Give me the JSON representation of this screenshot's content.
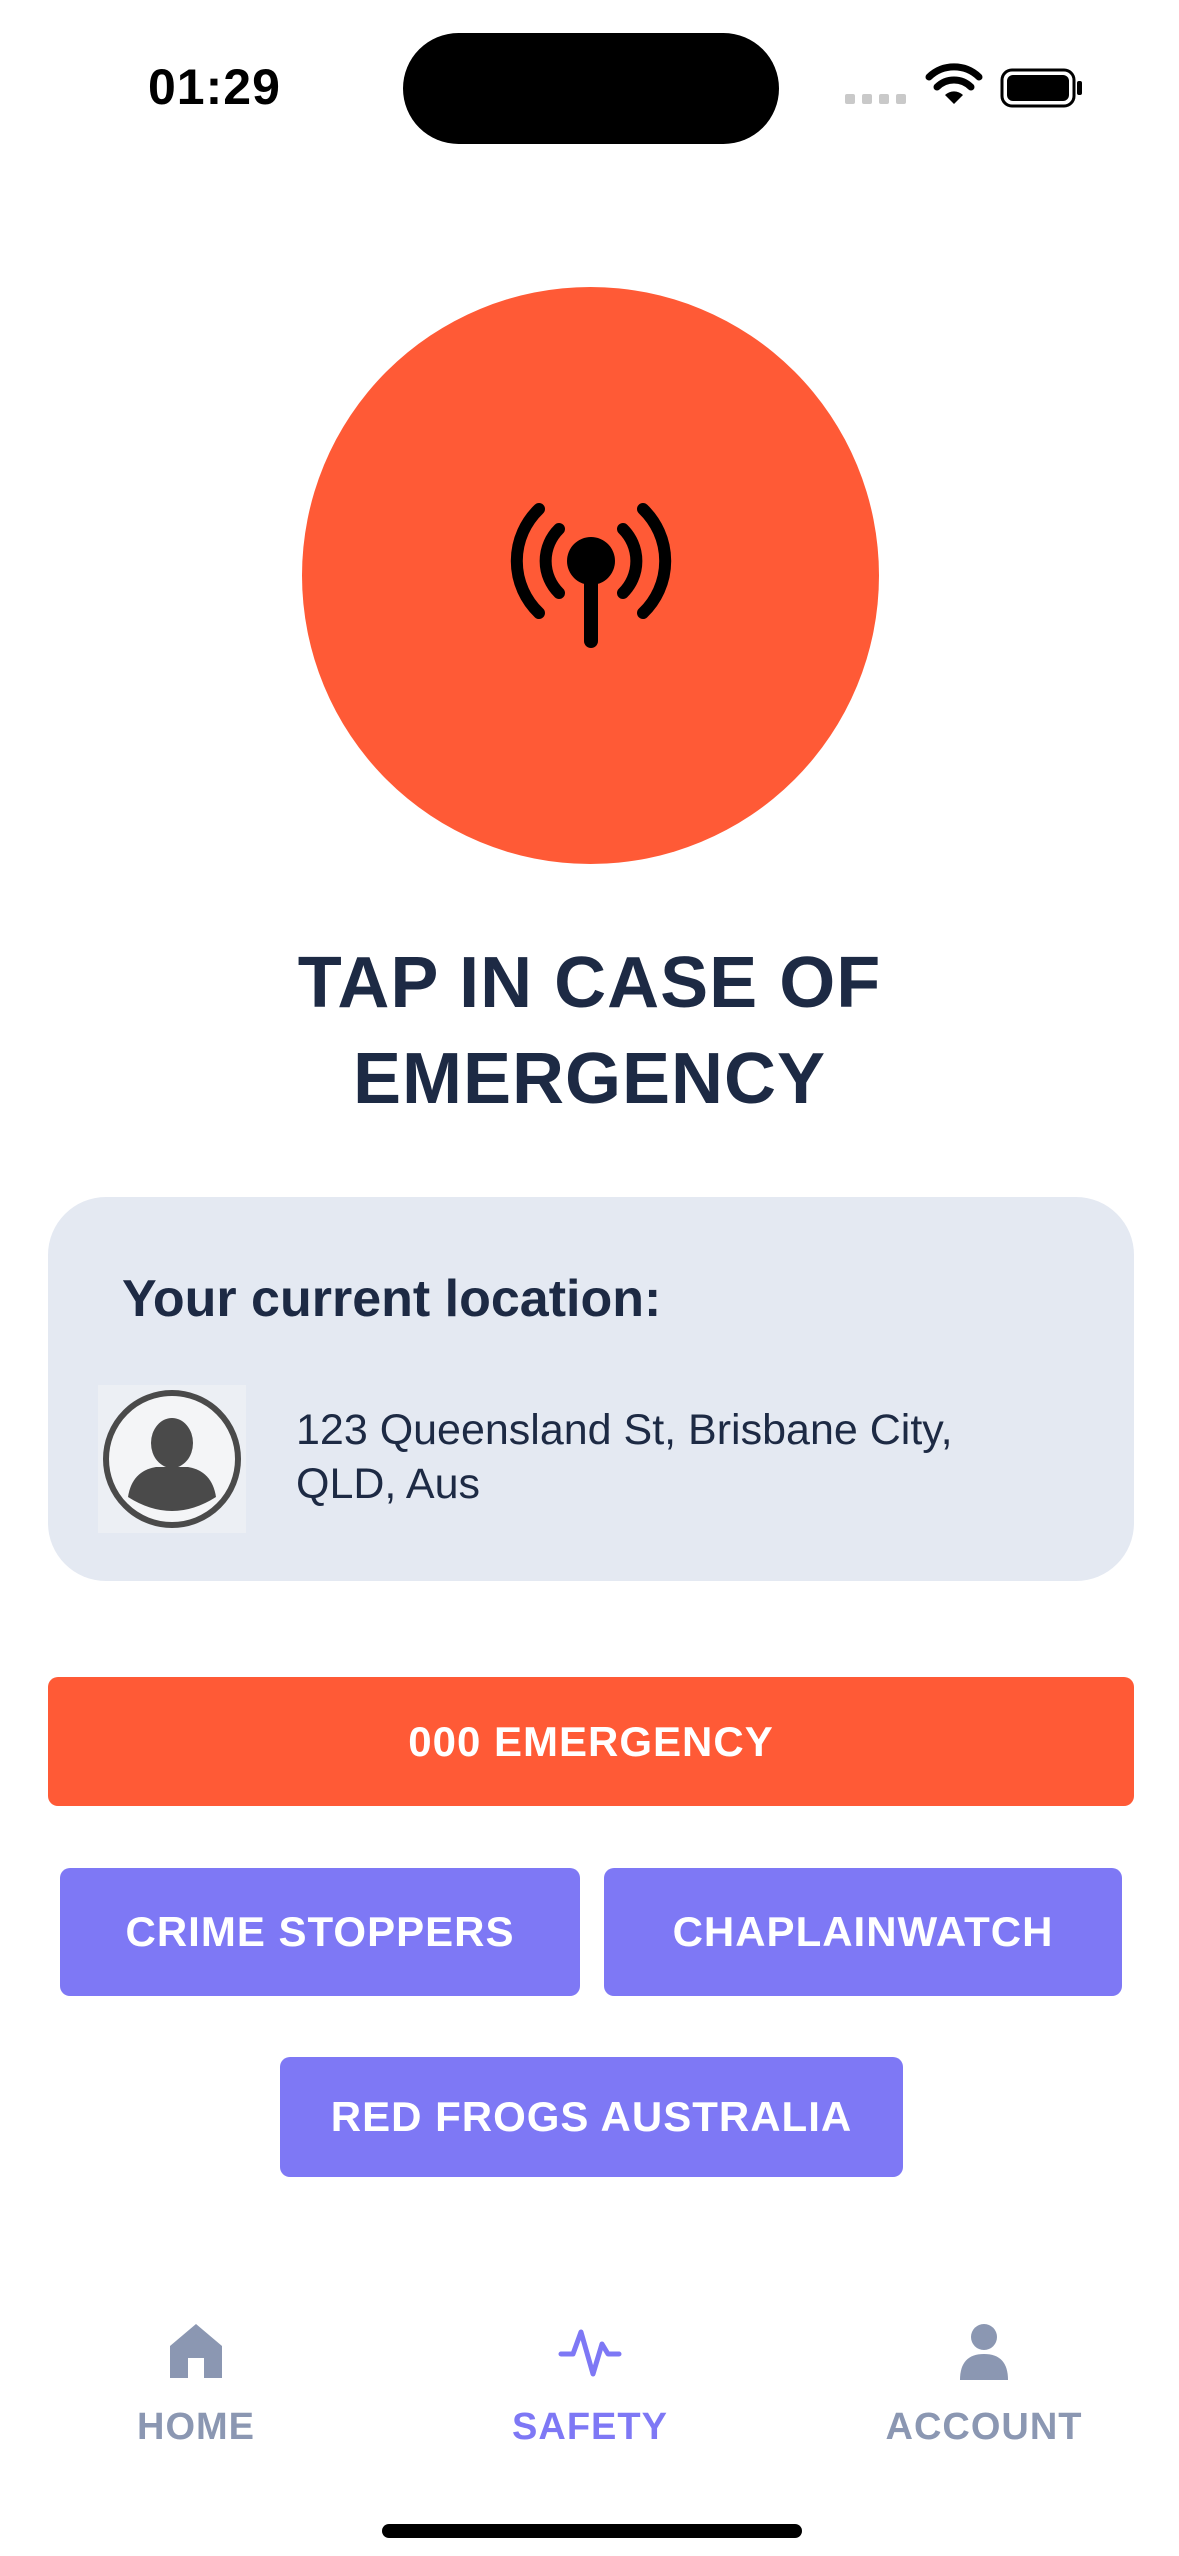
{
  "status_bar": {
    "time": "01:29"
  },
  "emergency_button": {
    "icon": "broadcast-icon",
    "color": "#ff5a36"
  },
  "headline": {
    "line1": "TAP IN CASE OF",
    "line2": "EMERGENCY"
  },
  "location": {
    "title": "Your current location:",
    "address_line1": "123 Queensland St, Brisbane City,",
    "address_line2": "QLD, Aus"
  },
  "buttons": {
    "emergency": "000 EMERGENCY",
    "crime_stoppers": "CRIME STOPPERS",
    "chaplainwatch": "CHAPLAINWATCH",
    "red_frogs": "RED FROGS AUSTRALIA"
  },
  "tabs": [
    {
      "label": "HOME",
      "icon": "home-icon",
      "active": false
    },
    {
      "label": "SAFETY",
      "icon": "activity-icon",
      "active": true
    },
    {
      "label": "ACCOUNT",
      "icon": "user-icon",
      "active": false
    }
  ],
  "colors": {
    "accent": "#ff5a36",
    "secondary": "#7e78f5",
    "text": "#1d2a44",
    "inactive_tab": "#8b97b2"
  }
}
